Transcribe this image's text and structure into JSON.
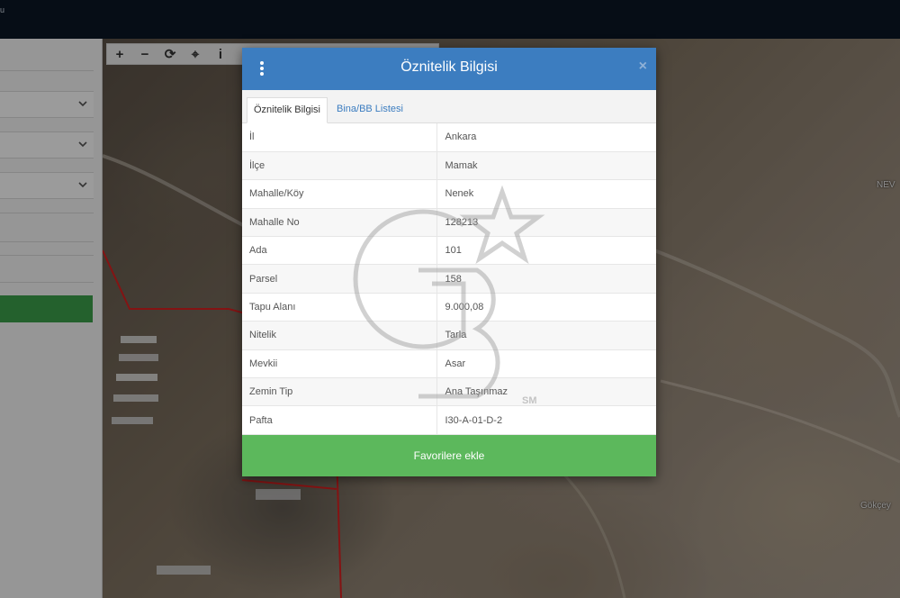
{
  "topbar": {
    "brand_text": "u"
  },
  "map": {
    "labels": {
      "nev": "NEV",
      "gokcey": "Gökçey"
    }
  },
  "map_toolbar": {
    "buttons": [
      {
        "name": "zoom-in",
        "glyph": "+"
      },
      {
        "name": "zoom-out",
        "glyph": "−"
      },
      {
        "name": "refresh",
        "glyph": "⟳"
      },
      {
        "name": "locate",
        "glyph": "⌖"
      },
      {
        "name": "info",
        "glyph": "i"
      }
    ]
  },
  "modal": {
    "title": "Öznitelik Bilgisi",
    "close_glyph": "×",
    "tabs": [
      {
        "label": "Öznitelik Bilgisi",
        "active": true
      },
      {
        "label": "Bina/BB Listesi",
        "active": false
      }
    ],
    "rows": [
      {
        "key": "İl",
        "value": "Ankara"
      },
      {
        "key": "İlçe",
        "value": "Mamak"
      },
      {
        "key": "Mahalle/Köy",
        "value": "Nenek"
      },
      {
        "key": "Mahalle No",
        "value": "128213"
      },
      {
        "key": "Ada",
        "value": "101"
      },
      {
        "key": "Parsel",
        "value": "158"
      },
      {
        "key": "Tapu Alanı",
        "value": "9.000,08"
      },
      {
        "key": "Nitelik",
        "value": "Tarla"
      },
      {
        "key": "Mevkii",
        "value": "Asar"
      },
      {
        "key": "Zemin Tip",
        "value": "Ana Taşınmaz"
      },
      {
        "key": "Pafta",
        "value": "I30-A-01-D-2"
      }
    ],
    "favorite_button": "Favorilere ekle"
  },
  "watermark": {
    "mark": "SM"
  },
  "colors": {
    "header_blue": "#3c7dc0",
    "button_green": "#5cb85c",
    "topbar": "#0a1624",
    "parcel_line": "#d62020"
  }
}
